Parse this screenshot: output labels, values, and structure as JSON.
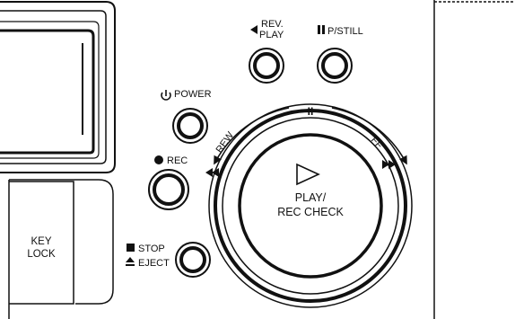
{
  "buttons": {
    "rev_play": {
      "label_line1": "REV.",
      "label_line2": "PLAY",
      "icon": "reverse-triangle-icon"
    },
    "pause_still": {
      "label": "P/STILL",
      "icon": "pause-bars-icon"
    },
    "power": {
      "label": "POWER",
      "icon": "power-symbol-icon"
    },
    "rec": {
      "label": "REC",
      "icon": "record-dot-icon"
    },
    "stop_eject": {
      "label_line1": "STOP",
      "label_line2": "EJECT",
      "icon_stop": "stop-square-icon",
      "icon_eject": "eject-icon"
    },
    "play_rec_check": {
      "label_line1": "PLAY/",
      "label_line2": "REC CHECK",
      "icon": "play-triangle-icon"
    }
  },
  "jog_ring": {
    "rew_label": "REW",
    "ff_label": "FF",
    "pause_mark": "II"
  },
  "key_lock": {
    "label_line1": "KEY",
    "label_line2": "LOCK"
  }
}
